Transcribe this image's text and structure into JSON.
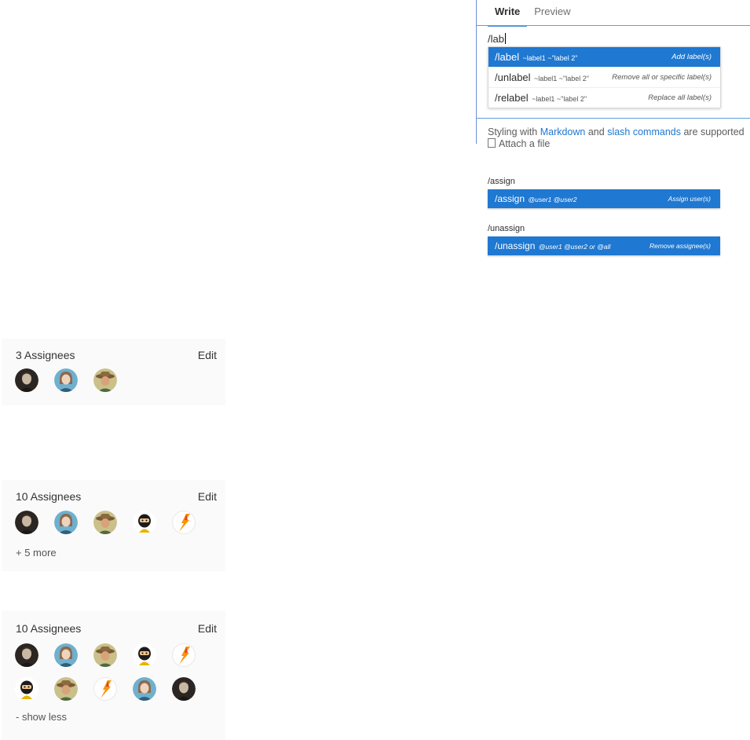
{
  "editor": {
    "tabs": {
      "write": "Write",
      "preview": "Preview"
    },
    "typed_text": "/lab",
    "suggestions": [
      {
        "command": "/label",
        "args": "~label1 ~\"label 2\"",
        "description": "Add label(s)",
        "active": true
      },
      {
        "command": "/unlabel",
        "args": "~label1 ~\"label 2\"",
        "description": "Remove all or specific label(s)",
        "active": false
      },
      {
        "command": "/relabel",
        "args": "~label1 ~\"label 2\"",
        "description": "Replace all label(s)",
        "active": false
      }
    ],
    "help": {
      "prefix": "Styling with ",
      "markdown_link": "Markdown",
      "middle": " and ",
      "slash_link": "slash commands",
      "suffix": " are supported"
    },
    "attach_label": "Attach a file"
  },
  "assign_example": {
    "typed": "/assign",
    "command": "/assign",
    "args": "@user1 @user2",
    "description": "Assign user(s)"
  },
  "unassign_example": {
    "typed": "/unassign",
    "command": "/unassign",
    "args": "@user1 @user2 or @all",
    "description": "Remove assignee(s)"
  },
  "panels": [
    {
      "title": "3 Assignees",
      "edit_label": "Edit",
      "avatars": [
        "user-dark",
        "user-blue",
        "user-hat"
      ]
    },
    {
      "title": "10 Assignees",
      "edit_label": "Edit",
      "avatars": [
        "user-dark",
        "user-blue",
        "user-hat",
        "user-ninja",
        "user-fox"
      ],
      "toggle_label": "+ 5 more"
    },
    {
      "title": "10 Assignees",
      "edit_label": "Edit",
      "avatars": [
        "user-dark",
        "user-blue",
        "user-hat",
        "user-ninja",
        "user-fox",
        "user-ninja",
        "user-hat",
        "user-fox",
        "user-blue",
        "user-dark"
      ],
      "toggle_label": "- show less"
    }
  ],
  "colors": {
    "accent": "#1f78d1",
    "tab_underline": "#4a8fd8",
    "panel_bg": "#fafafa",
    "fox_orange": "#fc9403"
  }
}
